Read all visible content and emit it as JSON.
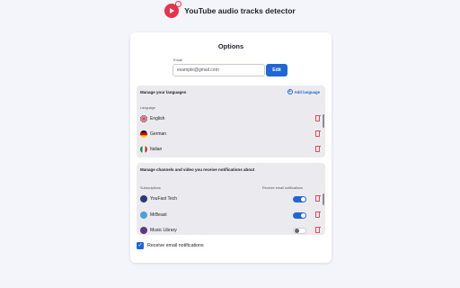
{
  "app": {
    "title": "YouTube audio tracks detector"
  },
  "options": {
    "title": "Options",
    "email_label": "Email",
    "email_value": "example@gmail.com",
    "edit_label": "Edit"
  },
  "languages": {
    "heading": "Manage your languages",
    "add_label": "Add language",
    "column_label": "Language",
    "items": [
      {
        "label": "English",
        "flag": "uk-flag-icon"
      },
      {
        "label": "German",
        "flag": "germany-flag-icon"
      },
      {
        "label": "Italian",
        "flag": "italy-flag-icon"
      }
    ]
  },
  "channels": {
    "heading": "Manage channels and video you receive notifications about",
    "col_subscriptions": "Subscriptions",
    "col_receive": "Receive email notifications",
    "items": [
      {
        "label": "YouFast Tech",
        "enabled": true,
        "color": "#2b3a78"
      },
      {
        "label": "MrBeast",
        "enabled": true,
        "color": "#4aa0d8"
      },
      {
        "label": "Music Library",
        "enabled": false,
        "color": "#5a3b80"
      }
    ]
  },
  "notifications": {
    "label": "Receive email notifications",
    "checked": true
  },
  "colors": {
    "accent": "#1f66d6",
    "danger": "#e24a5a",
    "panel": "#ebebef",
    "background": "#f4f4fb"
  }
}
